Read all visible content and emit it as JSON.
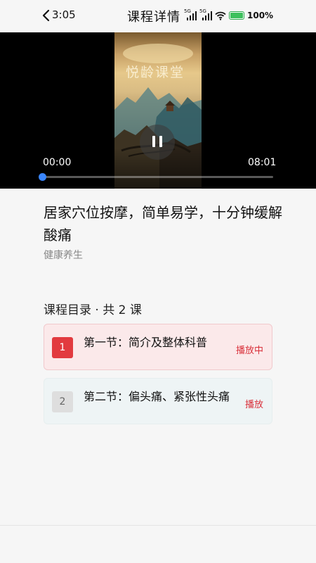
{
  "status_bar": {
    "time": "3:05",
    "signal_1": "5G",
    "signal_2": "5G",
    "battery": "100%"
  },
  "header": {
    "title": "课程详情",
    "back_icon": "chevron-left-icon"
  },
  "video": {
    "poster_text": "悦龄课堂",
    "current_time": "00:00",
    "total_time": "08:01",
    "progress": 0,
    "state": "playing",
    "pause_icon": "pause-icon",
    "accent_color": "#3a86ff"
  },
  "course": {
    "title": "居家穴位按摩，简单易学，十分钟缓解酸痛",
    "category": "健康养生"
  },
  "catalog": {
    "heading": "课程目录 · 共 2 课",
    "lessons": [
      {
        "number": "1",
        "title": "第一节：简介及整体科普",
        "status": "播放中",
        "active": true
      },
      {
        "number": "2",
        "title": "第二节：偏头痛、紧张性头痛",
        "status": "播放",
        "active": false
      }
    ],
    "active_color": "#e23a3f"
  }
}
